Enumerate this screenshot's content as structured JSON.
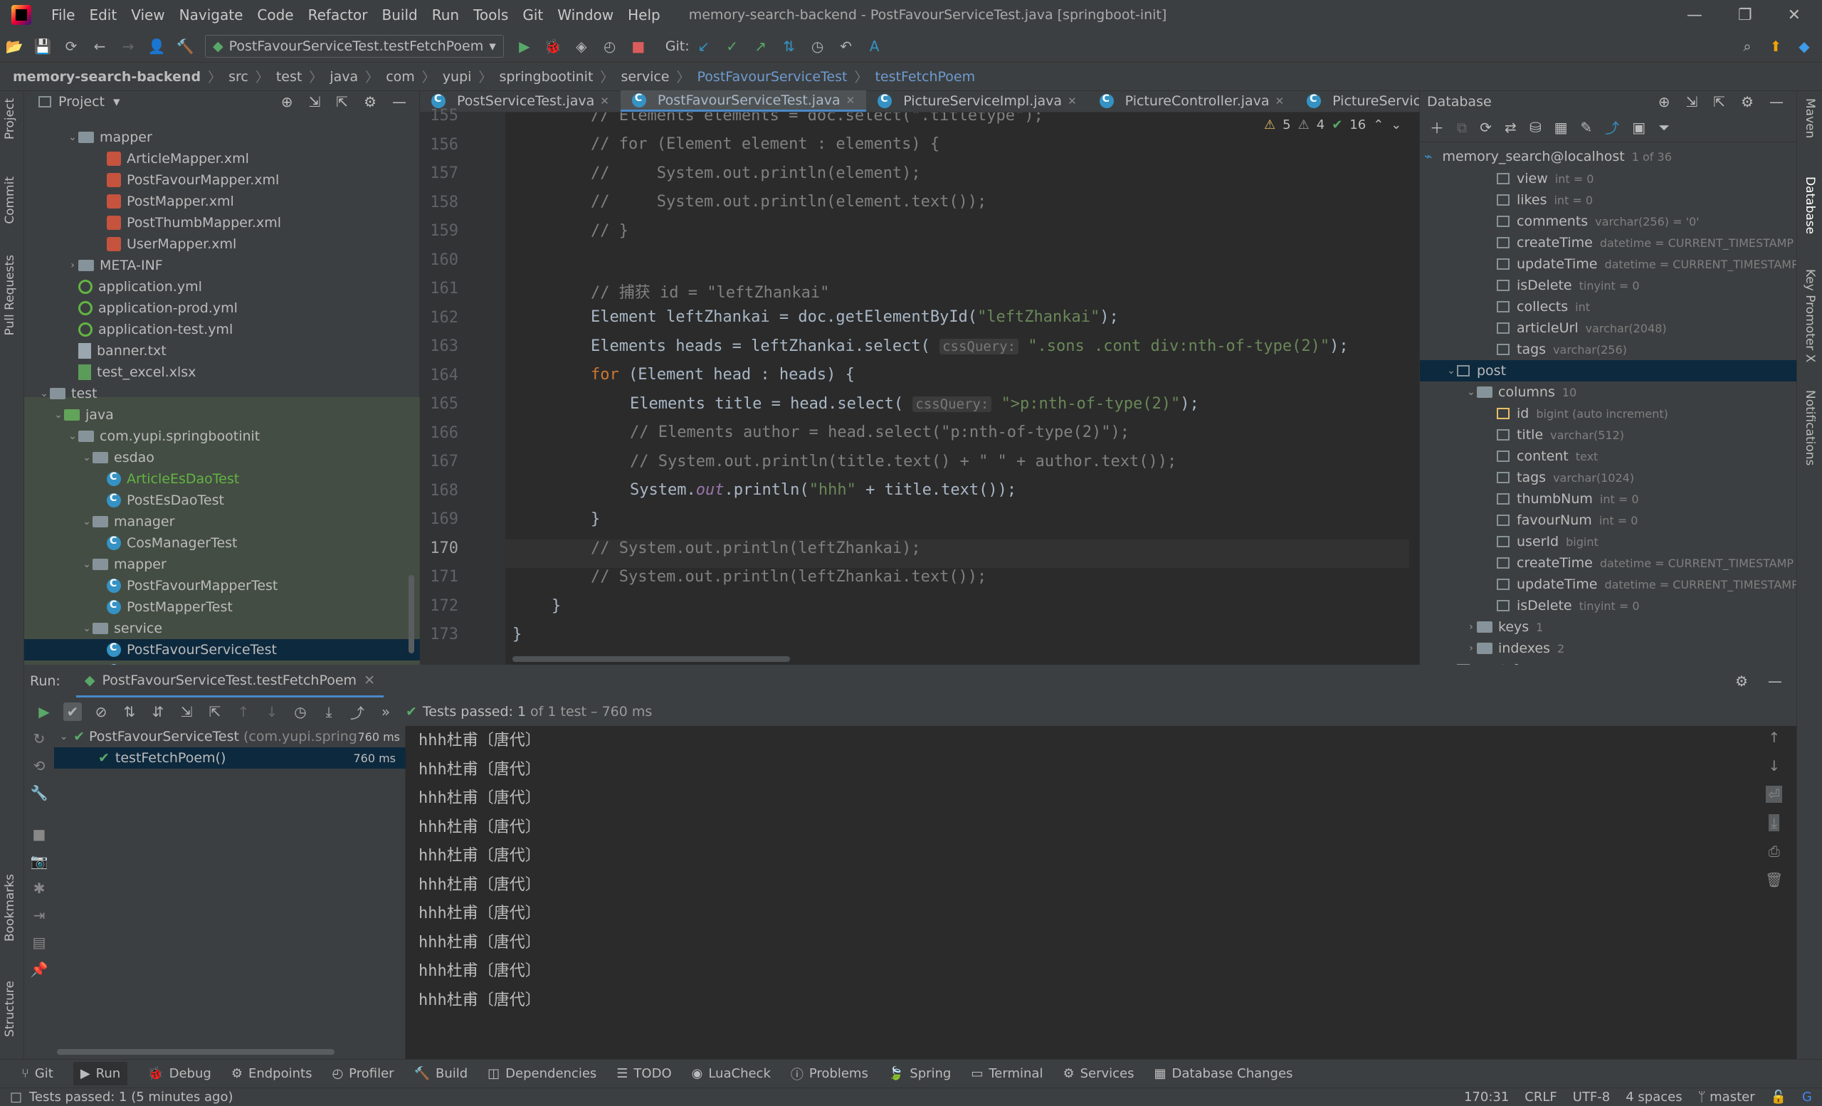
{
  "menu": [
    "File",
    "Edit",
    "View",
    "Navigate",
    "Code",
    "Refactor",
    "Build",
    "Run",
    "Tools",
    "Git",
    "Window",
    "Help"
  ],
  "window_title": "memory-search-backend - PostFavourServiceTest.java [springboot-init]",
  "window_buttons": {
    "minimize": "—",
    "restore": "❐",
    "close": "✕"
  },
  "toolbar": {
    "run_config": "PostFavourServiceTest.testFetchPoem",
    "git_label": "Git:"
  },
  "breadcrumb": [
    "memory-search-backend",
    "src",
    "test",
    "java",
    "com",
    "yupi",
    "springbootinit",
    "service",
    "PostFavourServiceTest",
    "testFetchPoem"
  ],
  "left_strip": {
    "project": "Project",
    "commit": "Commit",
    "pull_requests": "Pull Requests",
    "bookmarks": "Bookmarks",
    "structure": "Structure"
  },
  "right_strip": {
    "maven": "Maven",
    "database": "Database",
    "key_promoter": "Key Promoter X",
    "notifications": "Notifications"
  },
  "project": {
    "title": "Project",
    "tree": [
      {
        "label": "mapper",
        "indent": 5,
        "kind": "folder",
        "arrow": "⌄"
      },
      {
        "label": "ArticleMapper.xml",
        "indent": 7,
        "kind": "xml"
      },
      {
        "label": "PostFavourMapper.xml",
        "indent": 7,
        "kind": "xml"
      },
      {
        "label": "PostMapper.xml",
        "indent": 7,
        "kind": "xml"
      },
      {
        "label": "PostThumbMapper.xml",
        "indent": 7,
        "kind": "xml"
      },
      {
        "label": "UserMapper.xml",
        "indent": 7,
        "kind": "xml"
      },
      {
        "label": "META-INF",
        "indent": 5,
        "kind": "folder",
        "arrow": "›"
      },
      {
        "label": "application.yml",
        "indent": 5,
        "kind": "yml"
      },
      {
        "label": "application-prod.yml",
        "indent": 5,
        "kind": "yml"
      },
      {
        "label": "application-test.yml",
        "indent": 5,
        "kind": "yml"
      },
      {
        "label": "banner.txt",
        "indent": 5,
        "kind": "txt"
      },
      {
        "label": "test_excel.xlsx",
        "indent": 5,
        "kind": "xls"
      },
      {
        "label": "test",
        "indent": 3,
        "kind": "folder",
        "arrow": "⌄"
      },
      {
        "label": "java",
        "indent": 4,
        "kind": "folder-green",
        "arrow": "⌄"
      },
      {
        "label": "com.yupi.springbootinit",
        "indent": 5,
        "kind": "folder",
        "arrow": "⌄"
      },
      {
        "label": "esdao",
        "indent": 6,
        "kind": "folder",
        "arrow": "⌄"
      },
      {
        "label": "ArticleEsDaoTest",
        "indent": 7,
        "kind": "class",
        "green": true
      },
      {
        "label": "PostEsDaoTest",
        "indent": 7,
        "kind": "class"
      },
      {
        "label": "manager",
        "indent": 6,
        "kind": "folder",
        "arrow": "⌄"
      },
      {
        "label": "CosManagerTest",
        "indent": 7,
        "kind": "class"
      },
      {
        "label": "mapper",
        "indent": 6,
        "kind": "folder",
        "arrow": "⌄"
      },
      {
        "label": "PostFavourMapperTest",
        "indent": 7,
        "kind": "class"
      },
      {
        "label": "PostMapperTest",
        "indent": 7,
        "kind": "class"
      },
      {
        "label": "service",
        "indent": 6,
        "kind": "folder",
        "arrow": "⌄"
      },
      {
        "label": "PostFavourServiceTest",
        "indent": 7,
        "kind": "class",
        "selected": true
      },
      {
        "label": "PostServiceTest",
        "indent": 7,
        "kind": "class"
      }
    ]
  },
  "editor": {
    "tabs": [
      {
        "label": "PostServiceTest.java",
        "active": false
      },
      {
        "label": "PostFavourServiceTest.java",
        "active": true
      },
      {
        "label": "PictureServiceImpl.java",
        "active": false
      },
      {
        "label": "PictureController.java",
        "active": false
      },
      {
        "label": "PictureService.java",
        "active": false
      }
    ],
    "inspections": {
      "warnings": "5",
      "weak": "4",
      "ok": "16"
    },
    "line_numbers": [
      "155",
      "156",
      "157",
      "158",
      "159",
      "160",
      "161",
      "162",
      "163",
      "164",
      "165",
      "166",
      "167",
      "168",
      "169",
      "170",
      "171",
      "172",
      "173"
    ],
    "current_line": "170"
  },
  "database": {
    "title": "Database",
    "datasource": "memory_search@localhost",
    "datasource_count": "1 of 36",
    "rows": [
      {
        "label": "view",
        "type": "int = 0",
        "indent": 4,
        "kind": "col"
      },
      {
        "label": "likes",
        "type": "int = 0",
        "indent": 4,
        "kind": "col"
      },
      {
        "label": "comments",
        "type": "varchar(256) = '0'",
        "indent": 4,
        "kind": "col"
      },
      {
        "label": "createTime",
        "type": "datetime = CURRENT_TIMESTAMP",
        "indent": 4,
        "kind": "col"
      },
      {
        "label": "updateTime",
        "type": "datetime = CURRENT_TIMESTAMP",
        "indent": 4,
        "kind": "col"
      },
      {
        "label": "isDelete",
        "type": "tinyint = 0",
        "indent": 4,
        "kind": "col"
      },
      {
        "label": "collects",
        "type": "int",
        "indent": 4,
        "kind": "col"
      },
      {
        "label": "articleUrl",
        "type": "varchar(2048)",
        "indent": 4,
        "kind": "col"
      },
      {
        "label": "tags",
        "type": "varchar(256)",
        "indent": 4,
        "kind": "col"
      },
      {
        "label": "post",
        "type": "",
        "indent": 2,
        "kind": "table",
        "arrow": "⌄",
        "selected": true
      },
      {
        "label": "columns",
        "type": "10",
        "indent": 3,
        "kind": "folder",
        "arrow": "⌄"
      },
      {
        "label": "id",
        "type": "bigint (auto increment)",
        "indent": 4,
        "kind": "key"
      },
      {
        "label": "title",
        "type": "varchar(512)",
        "indent": 4,
        "kind": "col"
      },
      {
        "label": "content",
        "type": "text",
        "indent": 4,
        "kind": "col"
      },
      {
        "label": "tags",
        "type": "varchar(1024)",
        "indent": 4,
        "kind": "col"
      },
      {
        "label": "thumbNum",
        "type": "int = 0",
        "indent": 4,
        "kind": "col"
      },
      {
        "label": "favourNum",
        "type": "int = 0",
        "indent": 4,
        "kind": "col"
      },
      {
        "label": "userId",
        "type": "bigint",
        "indent": 4,
        "kind": "col"
      },
      {
        "label": "createTime",
        "type": "datetime = CURRENT_TIMESTAMP",
        "indent": 4,
        "kind": "col"
      },
      {
        "label": "updateTime",
        "type": "datetime = CURRENT_TIMESTAMP",
        "indent": 4,
        "kind": "col"
      },
      {
        "label": "isDelete",
        "type": "tinyint = 0",
        "indent": 4,
        "kind": "col"
      },
      {
        "label": "keys",
        "type": "1",
        "indent": 3,
        "kind": "folder",
        "arrow": "›"
      },
      {
        "label": "indexes",
        "type": "2",
        "indent": 3,
        "kind": "folder",
        "arrow": "›"
      },
      {
        "label": "post_favour",
        "type": "",
        "indent": 2,
        "kind": "table",
        "arrow": "›"
      }
    ]
  },
  "run": {
    "label": "Run:",
    "tab": "PostFavourServiceTest.testFetchPoem",
    "status_prefix": "Tests passed:",
    "status_count": "1",
    "status_detail": "of 1 test – 760 ms",
    "suite": {
      "name": "PostFavourServiceTest",
      "pkg": "(com.yupi.springboo",
      "time": "760 ms"
    },
    "test": {
      "name": "testFetchPoem()",
      "time": "760 ms"
    },
    "output": [
      "hhh杜甫〔唐代〕",
      "hhh杜甫〔唐代〕",
      "hhh杜甫〔唐代〕",
      "hhh杜甫〔唐代〕",
      "hhh杜甫〔唐代〕",
      "hhh杜甫〔唐代〕",
      "hhh杜甫〔唐代〕",
      "hhh杜甫〔唐代〕",
      "hhh杜甫〔唐代〕",
      "hhh杜甫〔唐代〕"
    ]
  },
  "bottom_tools": [
    "Git",
    "Run",
    "Debug",
    "Endpoints",
    "Profiler",
    "Build",
    "Dependencies",
    "TODO",
    "LuaCheck",
    "Problems",
    "Spring",
    "Terminal",
    "Services",
    "Database Changes"
  ],
  "statusbar": {
    "message": "Tests passed: 1 (5 minutes ago)",
    "position": "170:31",
    "line_sep": "CRLF",
    "encoding": "UTF-8",
    "indent": "4 spaces",
    "branch": "master"
  },
  "colors": {
    "accent": "#4a88c7",
    "keyword": "#cc7832",
    "string": "#6a8759",
    "comment": "#808080",
    "pass": "#59a869"
  }
}
